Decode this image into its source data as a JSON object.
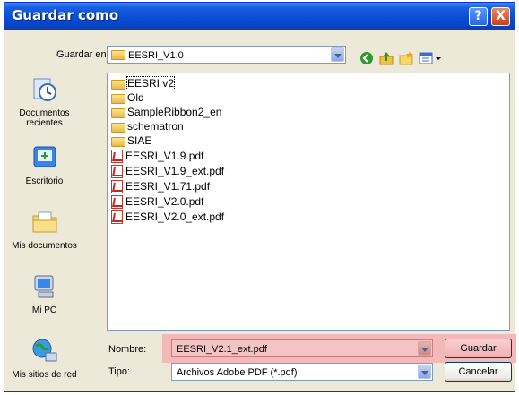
{
  "window": {
    "title": "Guardar como"
  },
  "title_buttons": {
    "help": "?",
    "close": "X"
  },
  "save_in": {
    "label": "Guardar en:",
    "value": "EESRI_V1.0"
  },
  "places": [
    {
      "label": "Documentos recientes",
      "icon": "recent-documents-icon"
    },
    {
      "label": "Escritorio",
      "icon": "desktop-icon"
    },
    {
      "label": "Mis documentos",
      "icon": "my-documents-icon"
    },
    {
      "label": "Mi PC",
      "icon": "my-computer-icon"
    },
    {
      "label": "Mis sitios de red",
      "icon": "network-places-icon"
    }
  ],
  "files": [
    {
      "name": "EESRI v2",
      "type": "folder"
    },
    {
      "name": "Old",
      "type": "folder"
    },
    {
      "name": "SampleRibbon2_en",
      "type": "folder"
    },
    {
      "name": "schematron",
      "type": "folder"
    },
    {
      "name": "SIAE",
      "type": "folder"
    },
    {
      "name": "EESRI_V1.9.pdf",
      "type": "pdf"
    },
    {
      "name": "EESRI_V1.9_ext.pdf",
      "type": "pdf"
    },
    {
      "name": "EESRI_V1.71.pdf",
      "type": "pdf"
    },
    {
      "name": "EESRI_V2.0.pdf",
      "type": "pdf"
    },
    {
      "name": "EESRI_V2.0_ext.pdf",
      "type": "pdf"
    }
  ],
  "filename": {
    "label": "Nombre:",
    "value": "EESRI_V2.1_ext.pdf"
  },
  "filetype": {
    "label": "Tipo:",
    "value": "Archivos Adobe PDF (*.pdf)"
  },
  "buttons": {
    "save": "Guardar",
    "cancel": "Cancelar"
  },
  "colors": {
    "titlebar": "#0a4ed6",
    "highlight": "#f4b8b8",
    "dialog": "#ece9d8"
  }
}
